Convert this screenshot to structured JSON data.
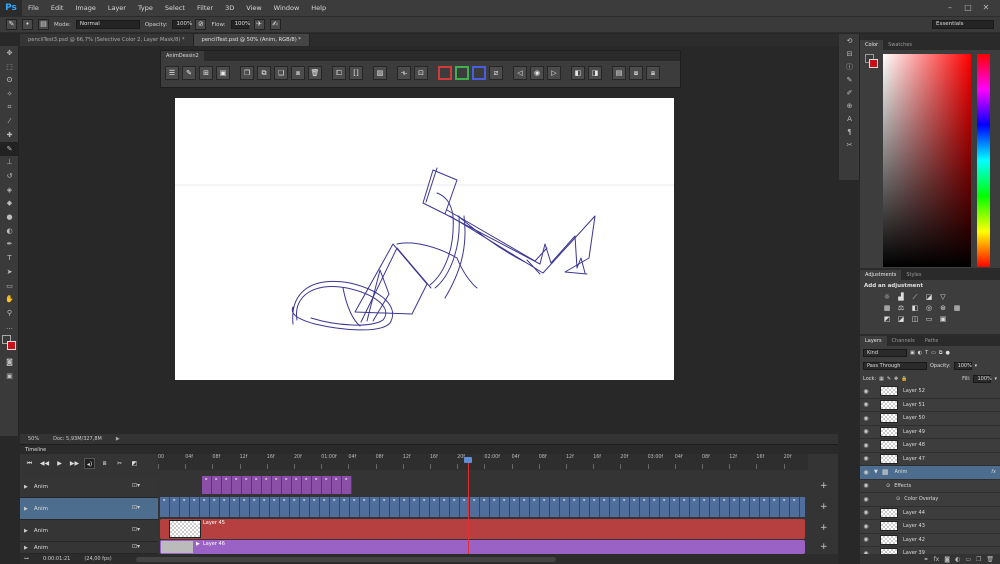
{
  "menubar": {
    "logo": "Ps",
    "items": [
      "File",
      "Edit",
      "Image",
      "Layer",
      "Type",
      "Select",
      "Filter",
      "3D",
      "View",
      "Window",
      "Help"
    ],
    "window_controls": [
      "–",
      "□",
      "✕"
    ]
  },
  "options": {
    "mode_label": "Mode:",
    "mode_value": "Normal",
    "opacity_label": "Opacity:",
    "opacity_value": "100%",
    "flow_label": "Flow:",
    "flow_value": "100%",
    "workspace": "Essentials"
  },
  "tabs": [
    {
      "label": "pencilTest3.psd @ 66,7% (Selective Color 2, Layer Mask/8) *",
      "active": false
    },
    {
      "label": "pencilTest.psd @ 50% (Anim, RGB/8) *",
      "active": true
    }
  ],
  "anim_panel": {
    "title": "AnimDessin2"
  },
  "status": {
    "zoom": "50%",
    "doc": "Doc: 5,93M/327,8M"
  },
  "timeline": {
    "title": "Timeline",
    "ticks": [
      "00",
      "04f",
      "08f",
      "12f",
      "16f",
      "20f",
      "01:00f",
      "04f",
      "08f",
      "12f",
      "16f",
      "20f",
      "02:00f",
      "04f",
      "08f",
      "12f",
      "16f",
      "20f",
      "03:00f",
      "04f",
      "08f",
      "12f",
      "16f",
      "20f"
    ],
    "rows": [
      {
        "name": "Anim",
        "selected": false
      },
      {
        "name": "Anim",
        "selected": true
      },
      {
        "name": "Anim",
        "selected": false
      },
      {
        "name": "Anim",
        "selected": false
      }
    ],
    "clip_layer45": "Layer 45",
    "clip_layer46": "Layer 46",
    "timecode": "0:00:01:21",
    "fps": "(24,00 fps)"
  },
  "right_panel": {
    "color_tabs": [
      "Color",
      "Swatches"
    ],
    "adj_tabs": [
      "Adjustments",
      "Styles"
    ],
    "adj_title": "Add an adjustment",
    "layer_tabs": [
      "Layers",
      "Channels",
      "Paths"
    ],
    "kind_filter": "Kind",
    "blend_mode": "Pass Through",
    "opacity_label": "Opacity:",
    "opacity_value": "100%",
    "lock_label": "Lock:",
    "fill_label": "Fill:",
    "fill_value": "100%",
    "layers": [
      {
        "name": "Layer 52",
        "kind": "layer"
      },
      {
        "name": "Layer 51",
        "kind": "layer"
      },
      {
        "name": "Layer 50",
        "kind": "layer"
      },
      {
        "name": "Layer 49",
        "kind": "layer"
      },
      {
        "name": "Layer 48",
        "kind": "layer"
      },
      {
        "name": "Layer 47",
        "kind": "layer"
      },
      {
        "name": "Anim",
        "kind": "group",
        "fx": "fx"
      },
      {
        "name": "Effects",
        "kind": "effects"
      },
      {
        "name": "Color Overlay",
        "kind": "effect"
      },
      {
        "name": "Layer 44",
        "kind": "layer"
      },
      {
        "name": "Layer 43",
        "kind": "layer"
      },
      {
        "name": "Layer 42",
        "kind": "layer"
      },
      {
        "name": "Layer 39",
        "kind": "layer"
      }
    ]
  },
  "colors": {
    "accent": "#4d6d8f",
    "clip_red": "#b64040",
    "clip_purple": "#8c4fa8",
    "clip_blue": "#4f6e9c",
    "clip_lavender": "#9a62c4",
    "sketch": "#3b3690"
  }
}
